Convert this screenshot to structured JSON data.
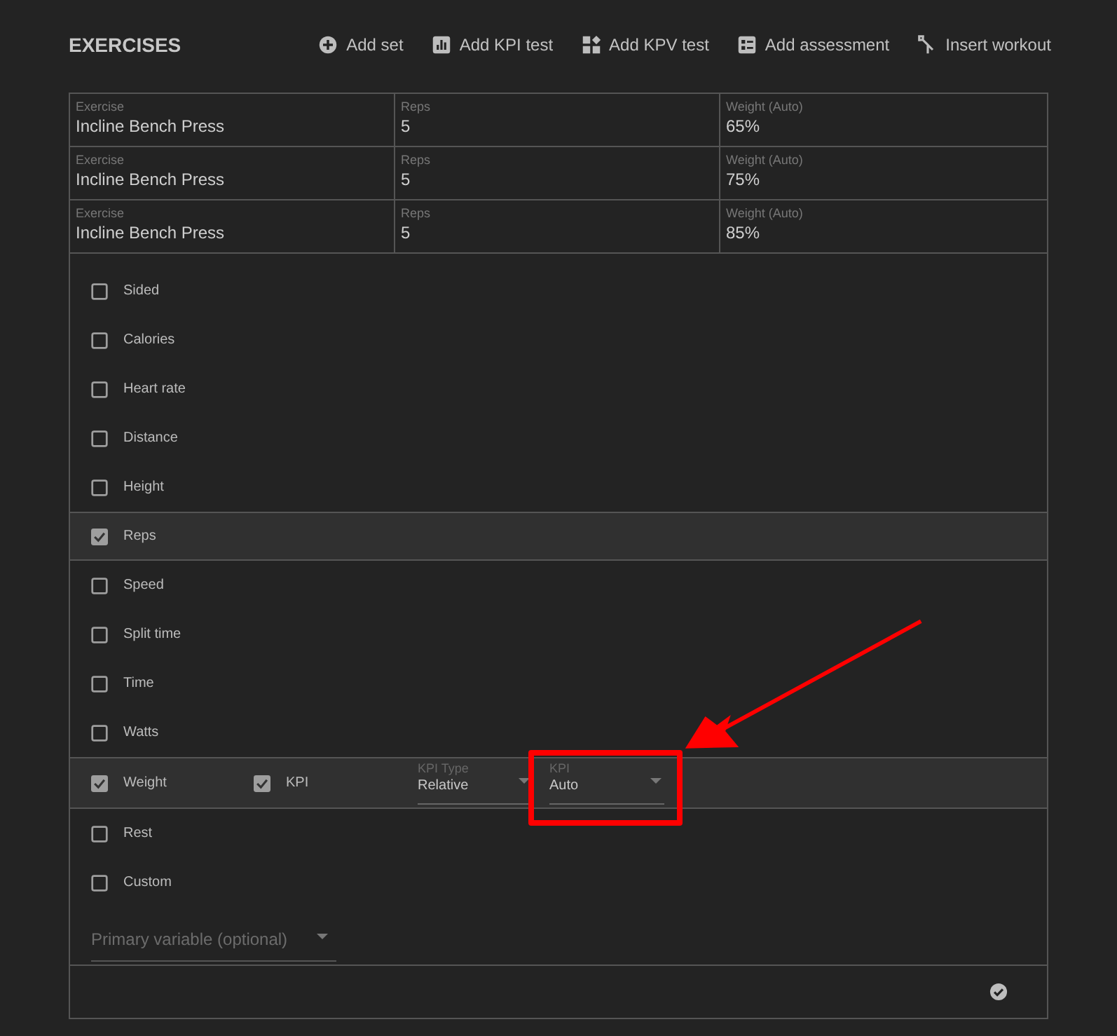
{
  "title": "EXERCISES",
  "actions": [
    {
      "label": "Add set",
      "kind": "plus"
    },
    {
      "label": "Add KPI test",
      "kind": "chart"
    },
    {
      "label": "Add KPV test",
      "kind": "widgets"
    },
    {
      "label": "Add assessment",
      "kind": "list"
    },
    {
      "label": "Insert workout",
      "kind": "merge"
    }
  ],
  "sets": [
    {
      "cells": [
        {
          "label": "Exercise",
          "value": "Incline Bench Press"
        },
        {
          "label": "Reps",
          "value": "5"
        },
        {
          "label": "Weight (Auto)",
          "value": "65%"
        }
      ]
    },
    {
      "cells": [
        {
          "label": "Exercise",
          "value": "Incline Bench Press"
        },
        {
          "label": "Reps",
          "value": "5"
        },
        {
          "label": "Weight (Auto)",
          "value": "75%"
        }
      ]
    },
    {
      "cells": [
        {
          "label": "Exercise",
          "value": "Incline Bench Press"
        },
        {
          "label": "Reps",
          "value": "5"
        },
        {
          "label": "Weight (Auto)",
          "value": "85%"
        }
      ]
    }
  ],
  "variables": [
    {
      "label": "Sided",
      "checked": false
    },
    {
      "label": "Calories",
      "checked": false
    },
    {
      "label": "Heart rate",
      "checked": false
    },
    {
      "label": "Distance",
      "checked": false
    },
    {
      "label": "Height",
      "checked": false
    },
    {
      "label": "Reps",
      "checked": true
    },
    {
      "label": "Speed",
      "checked": false
    },
    {
      "label": "Split time",
      "checked": false
    },
    {
      "label": "Time",
      "checked": false
    },
    {
      "label": "Watts",
      "checked": false
    },
    {
      "label": "Weight",
      "checked": true,
      "kpi": {
        "label": "KPI",
        "checked": true,
        "selects": [
          {
            "label": "KPI Type",
            "value": "Relative"
          },
          {
            "label": "KPI",
            "value": "Auto"
          }
        ]
      }
    },
    {
      "label": "Rest",
      "checked": false
    },
    {
      "label": "Custom",
      "checked": false
    }
  ],
  "primary_variable": {
    "placeholder": "Primary variable (optional)"
  },
  "annotation": {
    "kind": "highlight"
  }
}
